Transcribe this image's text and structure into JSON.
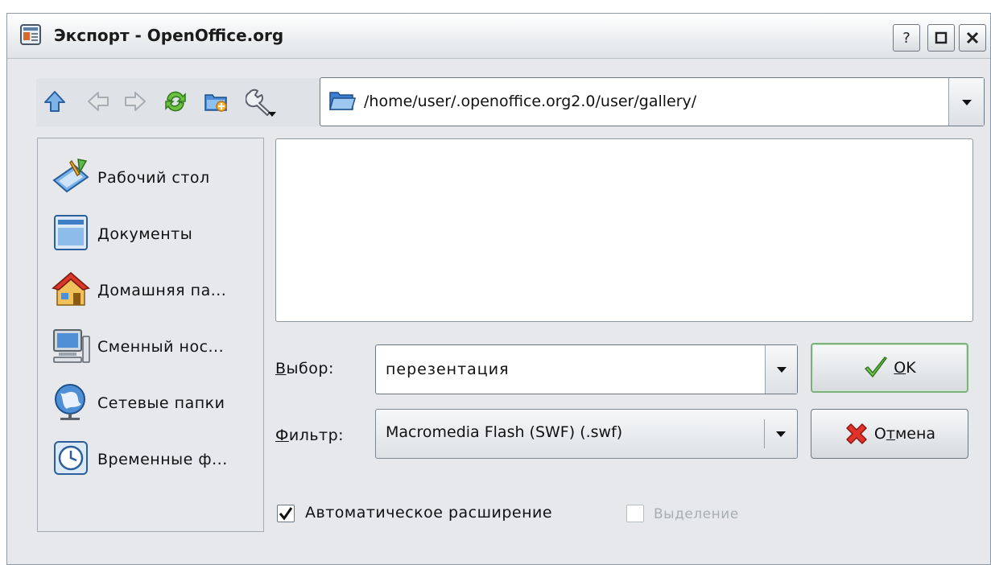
{
  "window": {
    "title": "Экспорт - OpenOffice.org",
    "help_label": "?",
    "maximize_label": "□",
    "close_label": "✕"
  },
  "toolbar": {
    "items": [
      "up-icon",
      "back-icon",
      "forward-icon",
      "reload-icon",
      "new-folder-icon",
      "configure-icon"
    ]
  },
  "path": {
    "value": "/home/user/.openoffice.org2.0/user/gallery/"
  },
  "places": {
    "items": [
      {
        "label": "Рабочий стол",
        "icon": "desktop-icon"
      },
      {
        "label": "Документы",
        "icon": "documents-icon"
      },
      {
        "label": "Домашняя па...",
        "icon": "home-icon"
      },
      {
        "label": "Сменный нос...",
        "icon": "removable-media-icon"
      },
      {
        "label": "Сетевые папки",
        "icon": "network-icon"
      },
      {
        "label": "Временные ф...",
        "icon": "temp-files-icon"
      }
    ]
  },
  "form": {
    "select_label": "Выбор:",
    "select_mnemonic": "В",
    "select_rest": "ыбор:",
    "select_value": "перезентация",
    "filter_label": "Фильтр:",
    "filter_mnemonic": "Ф",
    "filter_rest": "ильтр:",
    "filter_value": "Macromedia Flash (SWF) (.swf)"
  },
  "buttons": {
    "ok_label": "OK",
    "ok_mnemonic": "O",
    "ok_rest": "K",
    "cancel_label": "Отмена",
    "cancel_first": "О",
    "cancel_mnemonic": "т",
    "cancel_rest": "мена"
  },
  "options": {
    "auto_extension_label": "Автоматическое расширение",
    "auto_extension_checked": true,
    "selection_label": "Выделение",
    "selection_checked": false,
    "selection_enabled": false
  },
  "colors": {
    "window_bg": "#e6e8ec",
    "ok_focus": "#7bb27b",
    "disabled_text": "#a8aeb4"
  }
}
